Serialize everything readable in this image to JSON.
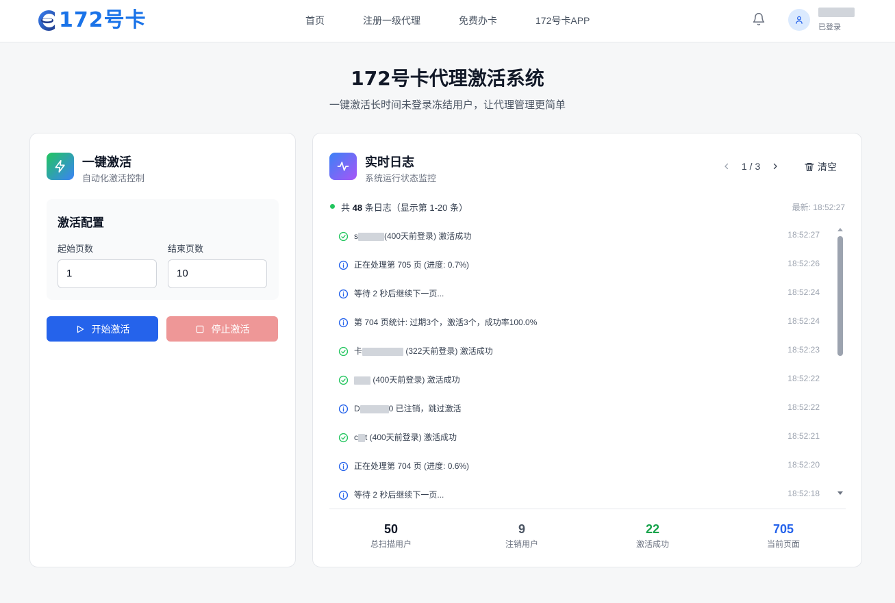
{
  "brand": {
    "logo_text": "172号卡"
  },
  "nav": {
    "items": [
      "首页",
      "注册一级代理",
      "免费办卡",
      "172号卡APP"
    ]
  },
  "user": {
    "status": "已登录"
  },
  "hero": {
    "title": "172号卡代理激活系统",
    "subtitle": "一键激活长时间未登录冻结用户，让代理管理更简单"
  },
  "activation": {
    "title": "一键激活",
    "subtitle": "自动化激活控制",
    "config_title": "激活配置",
    "start_page_label": "起始页数",
    "start_page_value": "1",
    "end_page_label": "结束页数",
    "end_page_value": "10",
    "start_button": "开始激活",
    "stop_button": "停止激活"
  },
  "log": {
    "title": "实时日志",
    "subtitle": "系统运行状态监控",
    "pager": "1 / 3",
    "clear_label": "清空",
    "summary_prefix": "共",
    "summary_count": "48",
    "summary_suffix": "条日志（显示第 1-20 条）",
    "latest": "最新: 18:52:27",
    "entries": [
      {
        "type": "success",
        "prefix": "s",
        "text": "(400天前登录) 激活成功",
        "time": "18:52:27"
      },
      {
        "type": "info",
        "prefix": "",
        "text": "正在处理第 705 页 (进度: 0.7%)",
        "time": "18:52:26"
      },
      {
        "type": "info",
        "prefix": "",
        "text": "等待 2 秒后继续下一页...",
        "time": "18:52:24"
      },
      {
        "type": "info",
        "prefix": "",
        "text": "第 704 页统计: 过期3个，激活3个，成功率100.0%",
        "time": "18:52:24"
      },
      {
        "type": "success",
        "prefix": "卡",
        "text": " (322天前登录) 激活成功",
        "time": "18:52:23"
      },
      {
        "type": "success",
        "prefix": "",
        "text": " (400天前登录) 激活成功",
        "time": "18:52:22"
      },
      {
        "type": "info",
        "prefix": "D",
        "text": "0 已注销，跳过激活",
        "time": "18:52:22"
      },
      {
        "type": "success",
        "prefix": "c",
        "text": "t (400天前登录) 激活成功",
        "time": "18:52:21"
      },
      {
        "type": "info",
        "prefix": "",
        "text": "正在处理第 704 页 (进度: 0.6%)",
        "time": "18:52:20"
      },
      {
        "type": "info",
        "prefix": "",
        "text": "等待 2 秒后继续下一页...",
        "time": "18:52:18"
      }
    ]
  },
  "stats": [
    {
      "value": "50",
      "label": "总扫描用户",
      "color": "#111827"
    },
    {
      "value": "9",
      "label": "注销用户",
      "color": "#4b5563"
    },
    {
      "value": "22",
      "label": "激活成功",
      "color": "#16a34a"
    },
    {
      "value": "705",
      "label": "当前页面",
      "color": "#2563eb"
    }
  ],
  "colors": {
    "primary": "#2563eb",
    "success": "#22c55e",
    "stop": "#ee9797"
  }
}
